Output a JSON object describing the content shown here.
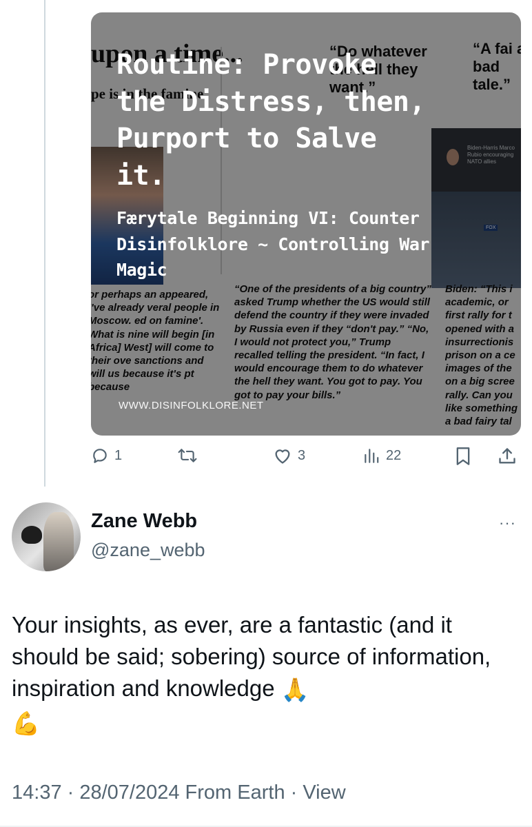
{
  "media": {
    "bg_clip_header_left": "upon a time...",
    "bg_clip_header_left_sub": "pe is in the famine",
    "bg_clip_quote_mid": "“Do whatever the hell they want.”",
    "bg_clip_quote_right": "“A fai a bad tale.”",
    "bg_right_subtitle": "Biden-Harris Marco Rubio encouraging NATO allies",
    "bg_right_tv_label": "FOX",
    "bg_col1": "or perhaps an appeared, I've already veral people in Moscow. ed on famine'. What is nine will begin [in Africa] West] will come to their ove sanctions and will us because it's pt because",
    "bg_col2": "“One of the presidents of a big country” asked Trump whether the US would still defend the country if they were invaded by Russia even if they “don't pay.” “No, I would not protect you,” Trump recalled telling the president. “In fact, I would encourage them to do whatever the hell they want. You got to pay. You got to pay your bills.”",
    "bg_col3": "Biden: “This i academic, or first rally for t opened with a insurrectionis prison on a ce images of the on a big scree rally. Can you like something a bad fairy tal",
    "headline": "Routine: Provoke the Distress, then, Purport to Salve it.",
    "subheadline": "Færytale Beginning VI: Counter Disinfolklore ~ Controlling War Magic",
    "watermark": "WWW.DISINFOLKLORE.NET"
  },
  "actions": {
    "reply_count": "1",
    "retweet_count": "",
    "like_count": "3",
    "view_count": "22"
  },
  "reply": {
    "name": "Zane Webb",
    "handle": "@zane_webb",
    "more": "···",
    "text": "Your insights, as ever, are a fantastic (and it should be said; sobering) source of information, inspiration and knowledge",
    "emoji1": "🙏",
    "emoji2": "💪",
    "meta": "14:37 · 28/07/2024 From Earth · View"
  },
  "colors": {
    "text_primary": "#0f1419",
    "text_secondary": "#536471",
    "thread_line": "#cfd9de"
  },
  "icons": [
    "reply-icon",
    "retweet-icon",
    "like-icon",
    "views-icon",
    "bookmark-icon",
    "share-icon",
    "more-icon"
  ]
}
